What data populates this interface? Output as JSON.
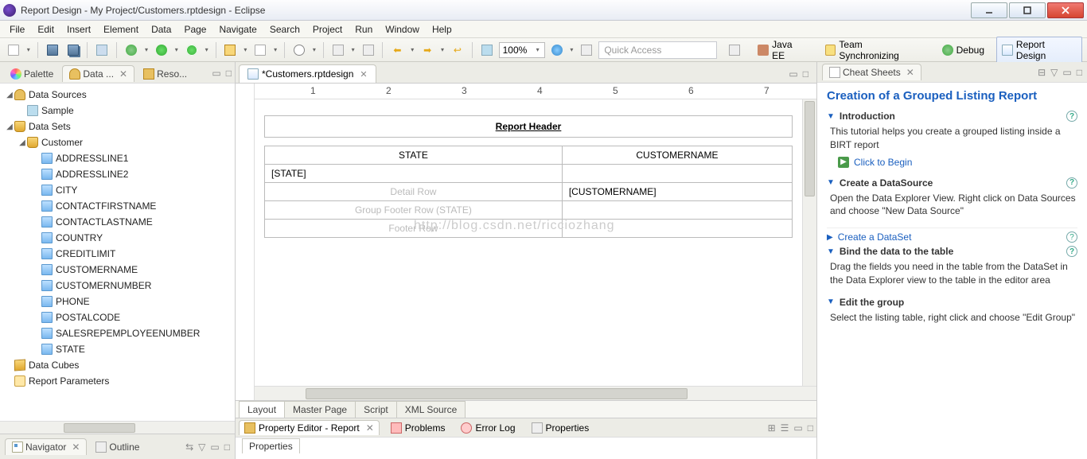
{
  "titlebar": {
    "text": "Report Design - My Project/Customers.rptdesign - Eclipse"
  },
  "menu": [
    "File",
    "Edit",
    "Insert",
    "Element",
    "Data",
    "Page",
    "Navigate",
    "Search",
    "Project",
    "Run",
    "Window",
    "Help"
  ],
  "toolbar": {
    "zoom": "100%",
    "quick_access_placeholder": "Quick Access"
  },
  "perspectives": [
    {
      "label": "Java EE"
    },
    {
      "label": "Team Synchronizing"
    },
    {
      "label": "Debug"
    },
    {
      "label": "Report Design",
      "active": true
    }
  ],
  "left_views": [
    {
      "label": "Palette"
    },
    {
      "label": "Data ...",
      "active": true
    },
    {
      "label": "Reso..."
    }
  ],
  "tree": {
    "data_sources": {
      "label": "Data Sources",
      "children": [
        {
          "label": "Sample"
        }
      ]
    },
    "data_sets": {
      "label": "Data Sets",
      "children": [
        {
          "label": "Customer",
          "children": [
            "ADDRESSLINE1",
            "ADDRESSLINE2",
            "CITY",
            "CONTACTFIRSTNAME",
            "CONTACTLASTNAME",
            "COUNTRY",
            "CREDITLIMIT",
            "CUSTOMERNAME",
            "CUSTOMERNUMBER",
            "PHONE",
            "POSTALCODE",
            "SALESREPEMPLOYEENUMBER",
            "STATE"
          ]
        }
      ]
    },
    "data_cubes": {
      "label": "Data Cubes"
    },
    "report_params": {
      "label": "Report Parameters"
    }
  },
  "nav_views": [
    {
      "label": "Navigator",
      "active": true
    },
    {
      "label": "Outline"
    }
  ],
  "editor": {
    "tab": "*Customers.rptdesign",
    "header": "Report Header",
    "cols": [
      "STATE",
      "CUSTOMERNAME"
    ],
    "group_cell": "[STATE]",
    "detail_label": "Detail Row",
    "detail_cell": "[CUSTOMERNAME]",
    "groupfooter": "Group Footer Row (STATE)",
    "footer": "Footer Row",
    "watermark": "http://blog.csdn.net/ricciozhang",
    "bottom_tabs": [
      "Layout",
      "Master Page",
      "Script",
      "XML Source"
    ]
  },
  "propeditor": {
    "tabs": [
      {
        "label": "Property Editor - Report",
        "active": true
      },
      {
        "label": "Problems"
      },
      {
        "label": "Error Log"
      },
      {
        "label": "Properties"
      }
    ],
    "body_tab": "Properties"
  },
  "cheat": {
    "view_tab": "Cheat Sheets",
    "title": "Creation of a Grouped Listing Report",
    "sections": [
      {
        "header": "Introduction",
        "body": "This tutorial helps you create a grouped listing inside a BIRT report",
        "link": "Click to Begin",
        "expanded": true
      },
      {
        "header": "Create a DataSource",
        "body": "Open the Data Explorer View. Right click on Data Sources and choose \"New Data Source\"",
        "expanded": true
      },
      {
        "header": "Create a DataSet",
        "collapsed": true
      },
      {
        "header": "Bind the data to the table",
        "body": "Drag the fields you need in the table from the DataSet in the Data Explorer view to the table in the editor area",
        "expanded": true
      },
      {
        "header": "Edit the group",
        "body": "Select the listing table, right click and choose \"Edit Group\"",
        "expanded": true
      }
    ]
  },
  "ruler_ticks": [
    1,
    2,
    3,
    4,
    5,
    6,
    7
  ]
}
